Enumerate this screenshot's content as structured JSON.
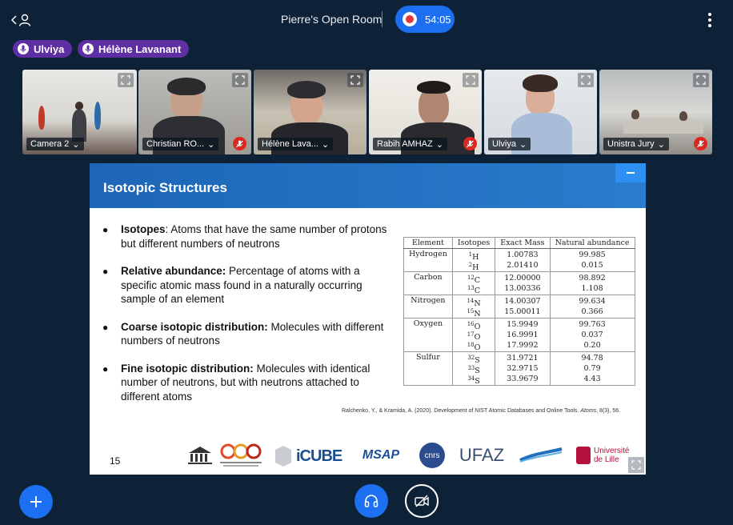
{
  "room": {
    "title": "Pierre's Open Room",
    "timer": "54:05"
  },
  "talkers": [
    {
      "name": "Ulviya"
    },
    {
      "name": "Hélène Lavanant"
    }
  ],
  "videos": [
    {
      "name": "Camera 2"
    },
    {
      "name": "Christian RO..."
    },
    {
      "name": "Hélène Lava..."
    },
    {
      "name": "Rabih AMHAZ"
    },
    {
      "name": "Ulviya"
    },
    {
      "name": "Unistra Jury"
    }
  ],
  "slide": {
    "title": "Isotopic Structures",
    "page_number": "15",
    "bullets": [
      {
        "term": "Isotopes",
        "text": ": Atoms that have the same number of protons but different numbers of neutrons"
      },
      {
        "term": "Relative abundance:",
        "text": " Percentage of atoms with a specific atomic mass found in a naturally occurring sample of an element"
      },
      {
        "term": "Coarse isotopic distribution:",
        "text": " Molecules with different numbers of neutrons"
      },
      {
        "term": "Fine isotopic distribution:",
        "text": " Molecules with identical number of neutrons, but with neutrons attached to different atoms"
      }
    ],
    "table": {
      "headers": [
        "Element",
        "Isotopes",
        "Exact Mass",
        "Natural abundance"
      ],
      "groups": [
        {
          "element": "Hydrogen",
          "isotopes": [
            {
              "mass_no": "1",
              "sym": "H",
              "mass": "1.00783",
              "abundance": "99.985"
            },
            {
              "mass_no": "2",
              "sym": "H",
              "mass": "2.01410",
              "abundance": "0.015"
            }
          ]
        },
        {
          "element": "Carbon",
          "isotopes": [
            {
              "mass_no": "12",
              "sym": "C",
              "mass": "12.00000",
              "abundance": "98.892"
            },
            {
              "mass_no": "13",
              "sym": "C",
              "mass": "13.00336",
              "abundance": "1.108"
            }
          ]
        },
        {
          "element": "Nitrogen",
          "isotopes": [
            {
              "mass_no": "14",
              "sym": "N",
              "mass": "14.00307",
              "abundance": "99.634"
            },
            {
              "mass_no": "15",
              "sym": "N",
              "mass": "15.00011",
              "abundance": "0.366"
            }
          ]
        },
        {
          "element": "Oxygen",
          "isotopes": [
            {
              "mass_no": "16",
              "sym": "O",
              "mass": "15.9949",
              "abundance": "99.763"
            },
            {
              "mass_no": "17",
              "sym": "O",
              "mass": "16.9991",
              "abundance": "0.037"
            },
            {
              "mass_no": "18",
              "sym": "O",
              "mass": "17.9992",
              "abundance": "0.20"
            }
          ]
        },
        {
          "element": "Sulfur",
          "isotopes": [
            {
              "mass_no": "32",
              "sym": "S",
              "mass": "31.9721",
              "abundance": "94.78"
            },
            {
              "mass_no": "33",
              "sym": "S",
              "mass": "32.9715",
              "abundance": "0.79"
            },
            {
              "mass_no": "34",
              "sym": "S",
              "mass": "33.9679",
              "abundance": "4.43"
            }
          ]
        }
      ]
    },
    "citation": {
      "text": "Ralchenko, Y., & Kramida, A. (2020). Development of NIST Atomic Databases and Online Tools. ",
      "journal": "Atoms",
      "tail": ", 8(3), 56."
    },
    "logos": [
      "iCUBE",
      "MSAP",
      "cnrs",
      "UFAZ",
      "Université de Lille"
    ]
  },
  "colors": {
    "accent": "#1b6ff0",
    "talker": "#5f2ea3",
    "muted": "#df2721",
    "background": "#0e2237"
  }
}
